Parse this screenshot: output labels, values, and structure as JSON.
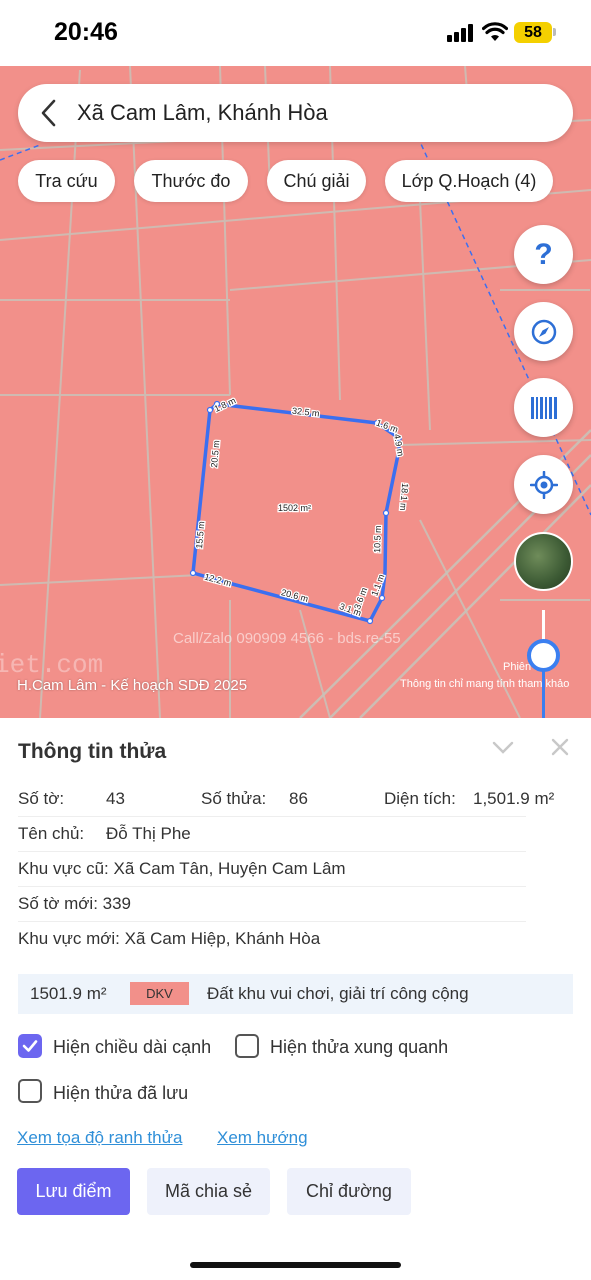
{
  "status_bar": {
    "time": "20:46",
    "battery": "58"
  },
  "search": {
    "title": "Xã Cam Lâm, Khánh Hòa"
  },
  "chips": [
    "Tra cứu",
    "Thước đo",
    "Chú giải",
    "Lớp Q.Hoạch (4)"
  ],
  "map": {
    "plan_label": "H.Cam Lâm - Kế hoạch SDĐ 2025",
    "ref_note": "Thông tin chỉ mang tính tham khảo",
    "version": "Phiên 4.1",
    "watermark": "Call/Zalo 090909 4566 - bds.re-55",
    "watermark2": "iet.com",
    "parcel_area": "1502 m²",
    "edges": [
      "1.8 m",
      "32.5 m",
      "1.6 m",
      "4.9 m",
      "18.1 m",
      "10.5 m",
      "1.1 m",
      "3.6 m",
      "3.1 m",
      "20.6 m",
      "12.2 m",
      "15.5 m",
      "20.5 m"
    ],
    "fab_help": "?"
  },
  "colors": {
    "map_fill": "#f2908a",
    "parcel_outline": "#3b6ff0",
    "accent": "#6c66f0",
    "link": "#2f8fd8"
  },
  "icons": [
    "back-chevron-icon",
    "compass-icon",
    "barcode-icon",
    "locate-icon",
    "chevron-down-icon",
    "close-icon",
    "check-icon"
  ],
  "panel": {
    "title": "Thông tin thửa",
    "so_to_label": "Số tờ:",
    "so_to": "43",
    "so_thua_label": "Số thửa:",
    "so_thua": "86",
    "dien_tich_label": "Diện tích:",
    "dien_tich": "1,501.9 m²",
    "ten_chu_label": "Tên chủ:",
    "ten_chu": "Đỗ Thị Phe",
    "khu_vuc_cu": "Khu vực cũ: Xã Cam Tân, Huyện Cam Lâm",
    "so_to_moi": "Số tờ mới: 339",
    "khu_vuc_moi": "Khu vực mới: Xã Cam Hiệp, Khánh Hòa",
    "land_use": {
      "area": "1501.9 m²",
      "code": "DKV",
      "description": "Đất khu vui chơi, giải trí công cộng"
    },
    "options": {
      "edge_lengths": {
        "label": "Hiện chiều dài cạnh",
        "checked": true
      },
      "neighbors": {
        "label": "Hiện thửa xung quanh",
        "checked": false
      },
      "saved": {
        "label": "Hiện thửa đã lưu",
        "checked": false
      }
    },
    "links": {
      "coords": "Xem tọa độ ranh thửa",
      "direction": "Xem hướng"
    },
    "buttons": {
      "save": "Lưu điểm",
      "share": "Mã chia sẻ",
      "route": "Chỉ đường"
    }
  }
}
